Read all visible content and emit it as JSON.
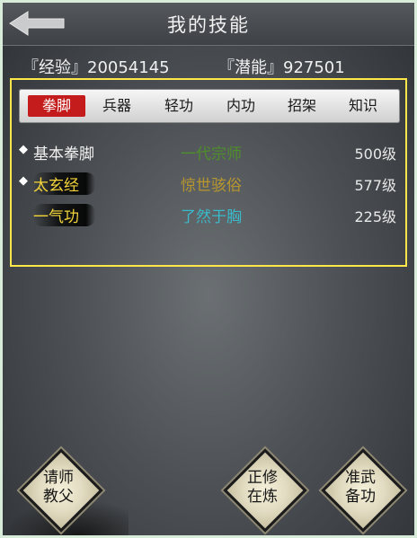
{
  "header": {
    "title": "我的技能"
  },
  "stats": {
    "experience": "『经验』20054145",
    "potential": "『潜能』927501"
  },
  "tabs": [
    {
      "label": "拳脚",
      "active": true
    },
    {
      "label": "兵器",
      "active": false
    },
    {
      "label": "轻功",
      "active": false
    },
    {
      "label": "内功",
      "active": false
    },
    {
      "label": "招架",
      "active": false
    },
    {
      "label": "知识",
      "active": false
    }
  ],
  "skills": [
    {
      "bullet": "◆",
      "name": "基本拳脚",
      "rank": "一代宗师",
      "level": "500级",
      "name_color": "#f2f2f2",
      "rank_color": "#4f8f2b"
    },
    {
      "bullet": "◆",
      "name": "太玄经",
      "rank": "惊世骇俗",
      "level": "577级",
      "name_color": "#f3d53a",
      "rank_color": "#b8962f"
    },
    {
      "bullet": "",
      "name": "一气功",
      "rank": "了然于胸",
      "level": "225级",
      "name_color": "#f3d53a",
      "rank_color": "#3ab9c9"
    }
  ],
  "buttons": {
    "teacher": {
      "line1": "请师",
      "line2": "教父"
    },
    "practice": {
      "line1": "正修",
      "line2": "在炼"
    },
    "prepare": {
      "line1": "准武",
      "line2": "备功"
    }
  },
  "colors": {
    "accent_border": "#ffe64a",
    "active_tab": "#c41c1c"
  }
}
